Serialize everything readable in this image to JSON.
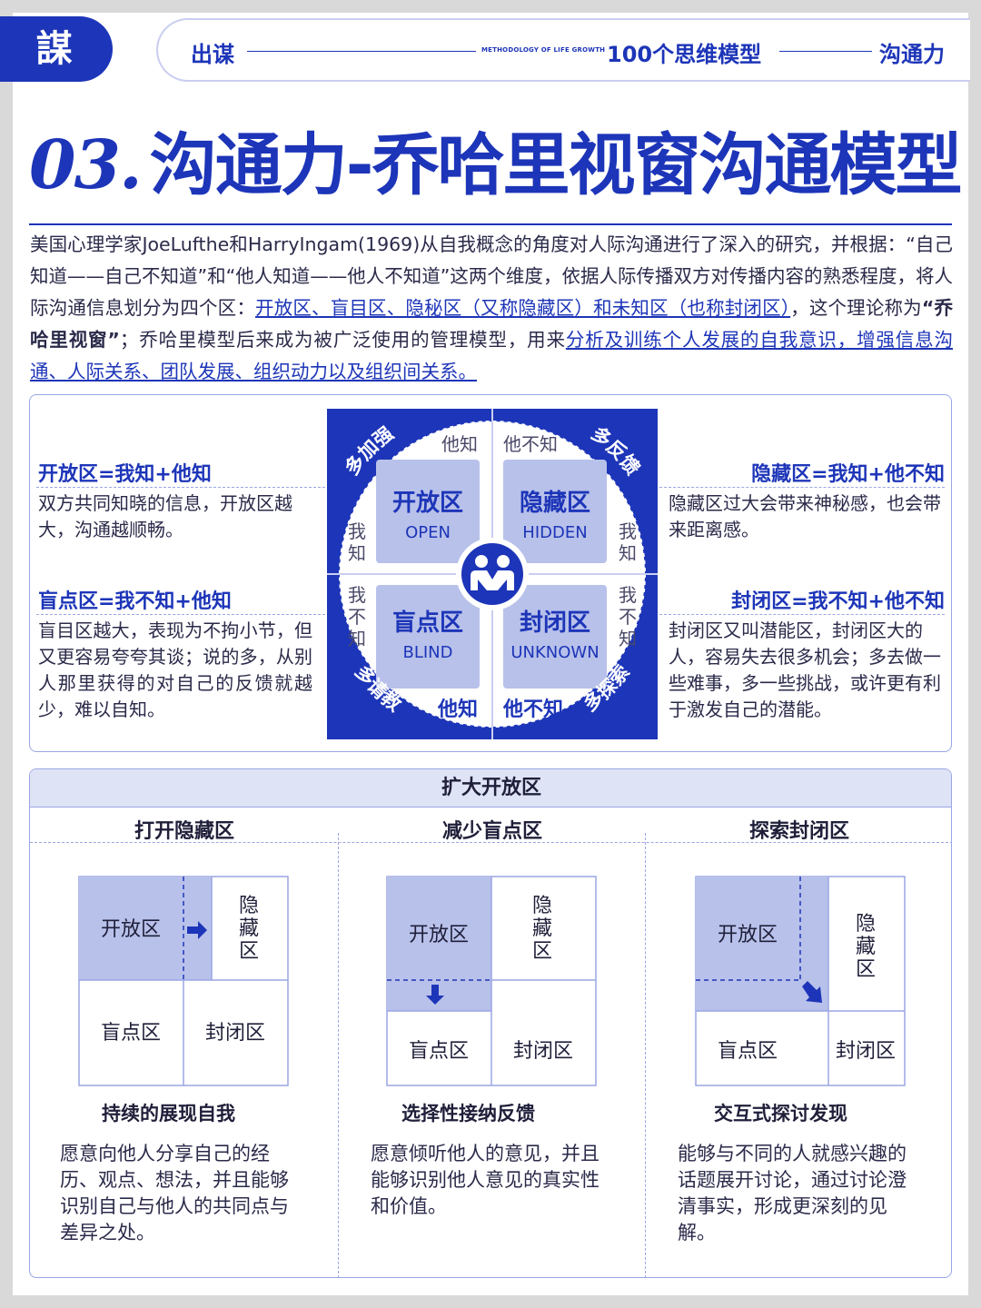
{
  "header": {
    "logo_text": "謀",
    "left_label": "出谋",
    "methodology": "METHODOLOGY OF LIFE GROWTH",
    "center_label": "100个思维模型",
    "right_label": "沟通力"
  },
  "title": {
    "number": "03.",
    "text": "沟通力-乔哈里视窗沟通模型"
  },
  "intro": {
    "p1": "美国心理学家JoeLufthe和HarryIngam(1969)从自我概念的角度对人际沟通进行了深入的研究，并根据：“自己知道——自己不知道”和“他人知道——他人不知道”这两个维度，依据人际传播双方对传播内容的熟悉程度，将人际沟通信息划分为四个区：",
    "u1": "开放区、盲目区、隐秘区（又称隐藏区）和未知区（也称封闭区）",
    "p2": "，这个理论称为",
    "bold": "“乔哈里视窗”",
    "p3": "；乔哈里模型后来成为被广泛使用的管理模型，用来",
    "u2": "分析及训练个人发展的自我意识，增强信息沟通、人际关系、团队发展、组织动力以及组织间关系。"
  },
  "window": {
    "open": {
      "label": "开放区=我知+他知",
      "desc": "双方共同知晓的信息，开放区越大，沟通越顺畅。",
      "cn": "开放区",
      "en": "OPEN"
    },
    "hidden": {
      "label": "隐藏区=我知+他不知",
      "desc": "隐藏区过大会带来神秘感，也会带来距离感。",
      "cn": "隐藏区",
      "en": "HIDDEN"
    },
    "blind": {
      "label": "盲点区=我不知+他知",
      "desc": "盲目区越大，表现为不拘小节，但又更容易夸夸其谈；说的多，从别人那里获得的对自己的反馈就越少，难以自知。",
      "cn": "盲点区",
      "en": "BLIND"
    },
    "unknown": {
      "label": "封闭区=我不知+他不知",
      "desc": "封闭区又叫潜能区，封闭区大的人，容易失去很多机会；多去做一些难事，多一些挑战，或许更有利于激发自己的潜能。",
      "cn": "封闭区",
      "en": "UNKNOWN"
    },
    "others_know": "他知",
    "others_dont_know": "他不知",
    "self_know": "我知",
    "self_dont_know": "我不知",
    "corner_tl": "多加强",
    "corner_tr": "多反馈",
    "corner_bl": "多请教",
    "corner_br": "多探索"
  },
  "expand": {
    "heading": "扩大开放区",
    "columns": [
      {
        "head": "打开隐藏区",
        "sub": "持续的展现自我",
        "desc": "愿意向他人分享自己的经历、观点、想法，并且能够识别自己与他人的共同点与差异之处。"
      },
      {
        "head": "减少盲点区",
        "sub": "选择性接纳反馈",
        "desc": "愿意倾听他人的意见，并且能够识别他人意见的真实性和价值。"
      },
      {
        "head": "探索封闭区",
        "sub": "交互式探讨发现",
        "desc": "能够与不同的人就感兴趣的话题展开讨论，通过讨论澄清事实，形成更深刻的见解。"
      }
    ],
    "cell_open": "开放区",
    "cell_hidden": "隐藏区",
    "cell_blind": "盲点区",
    "cell_unknown": "封闭区",
    "colors": {
      "accent": "#1d35b8",
      "fill": "#b8c1ea",
      "light": "#dfe3f6"
    }
  }
}
